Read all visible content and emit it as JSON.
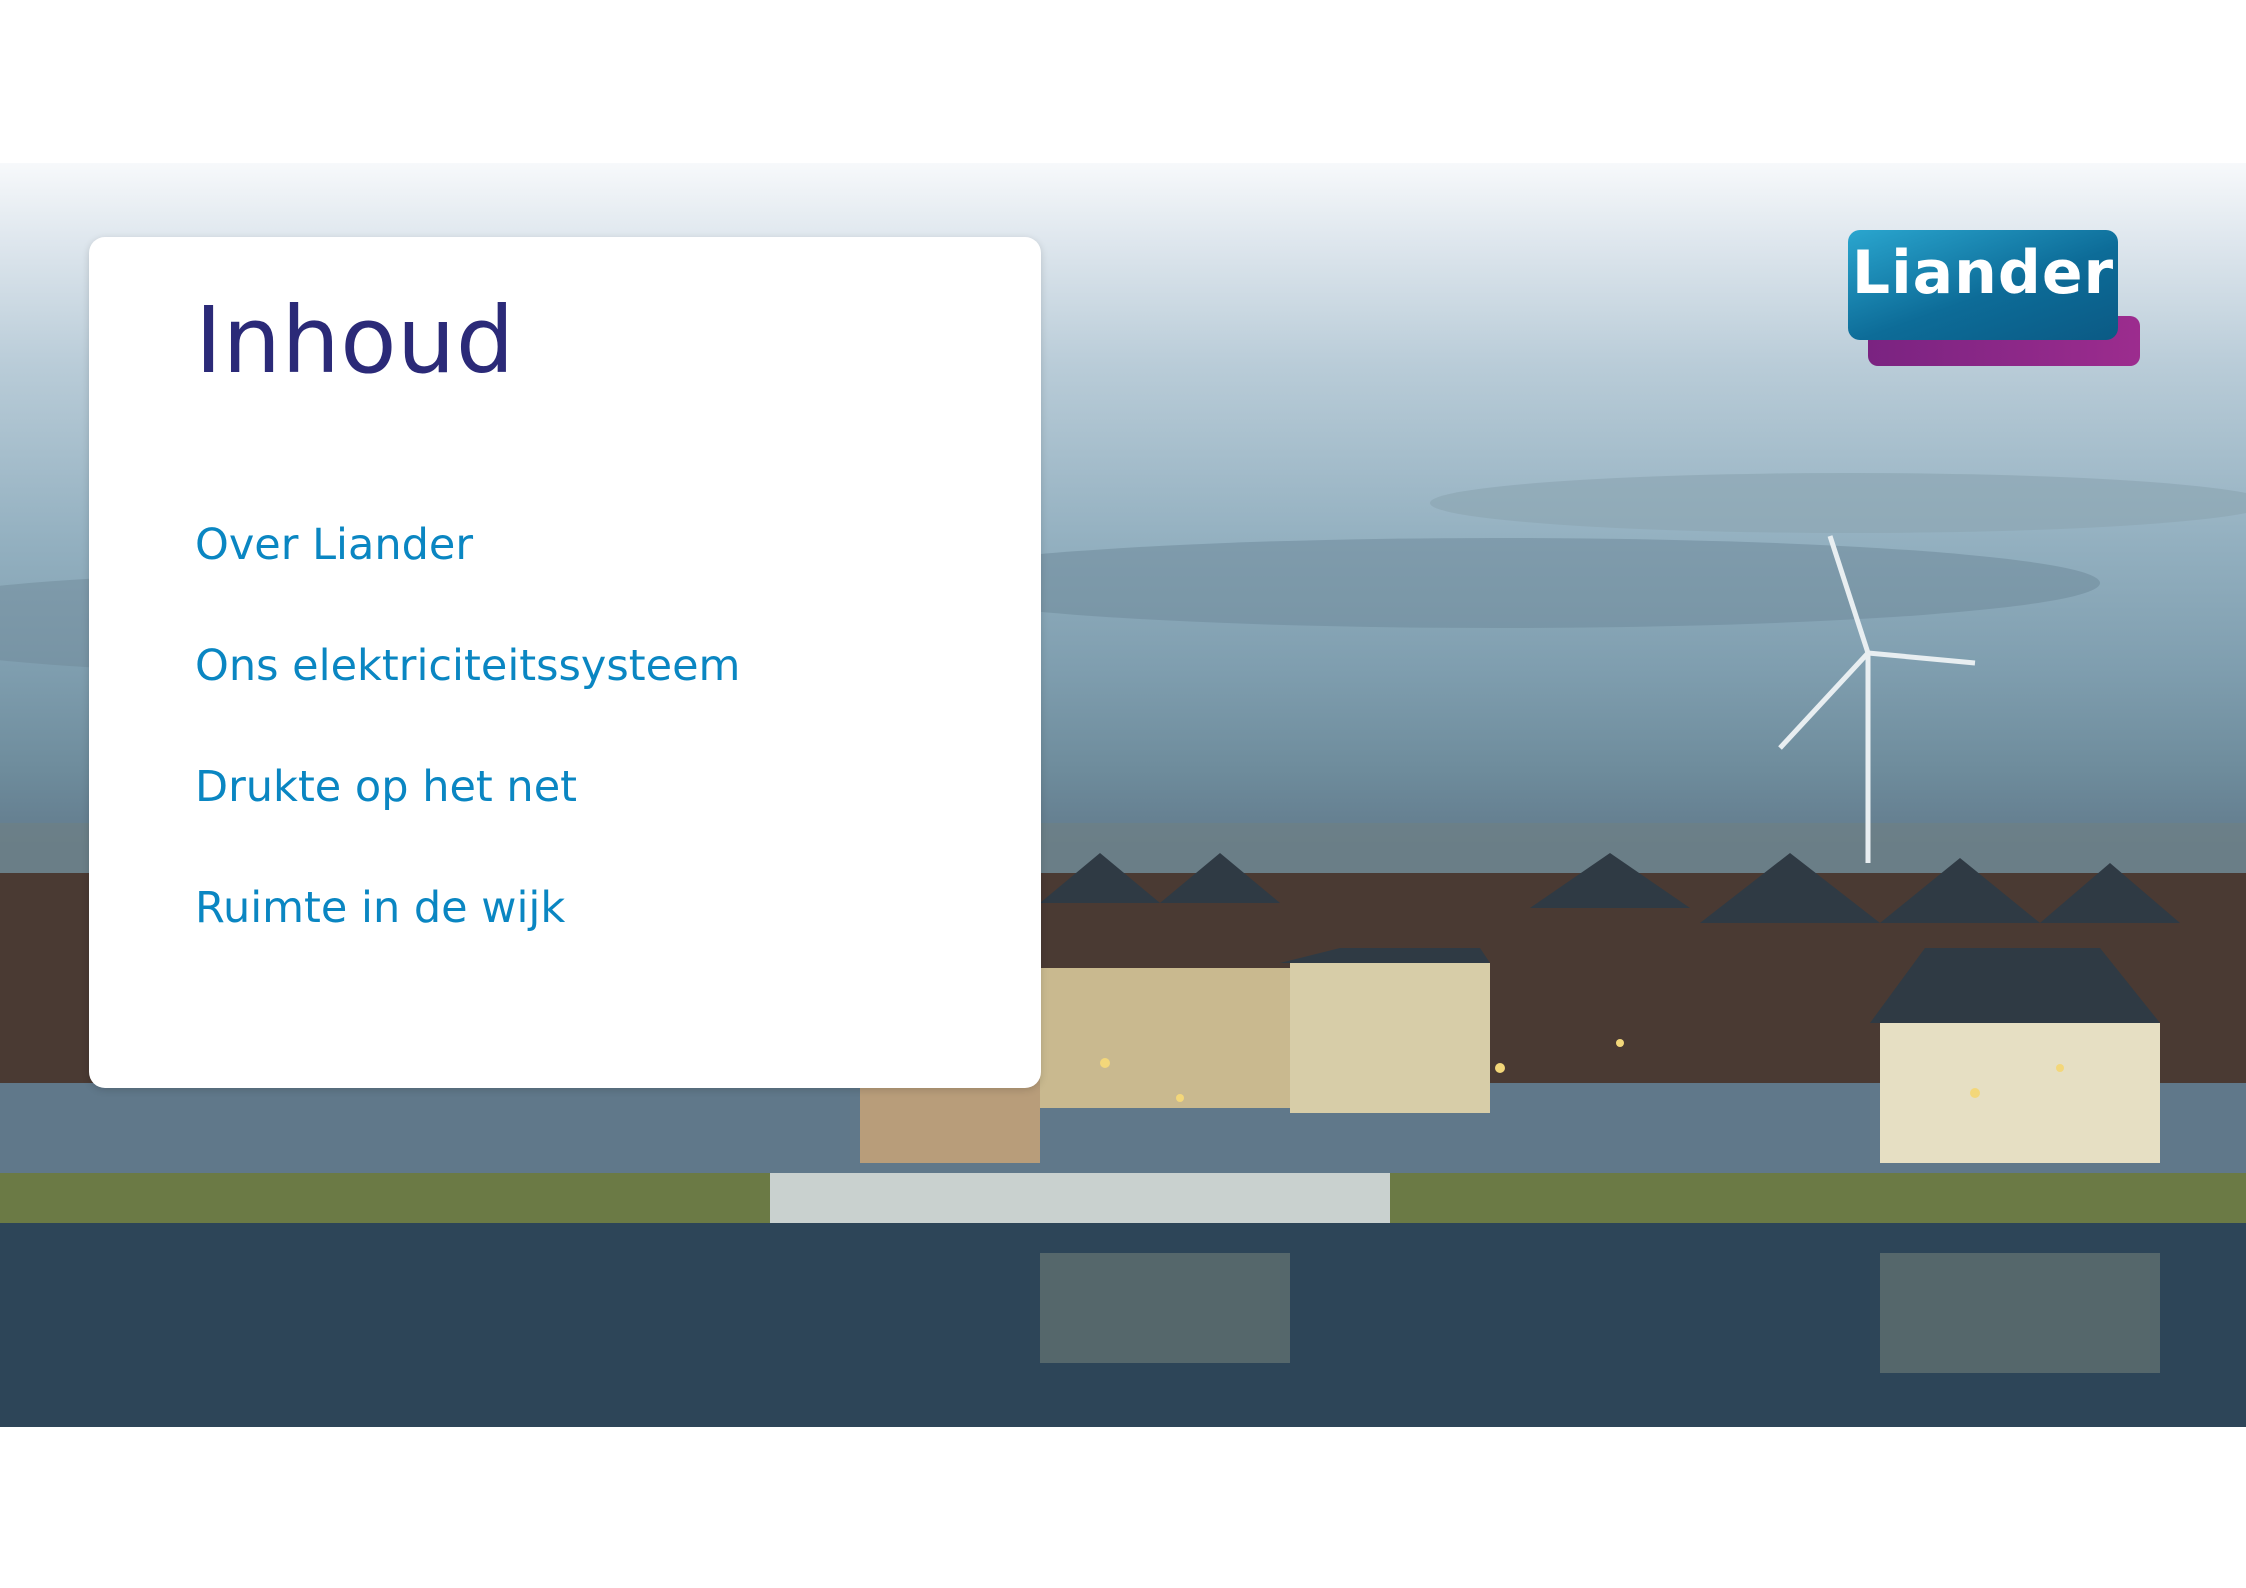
{
  "slide": {
    "title": "Inhoud",
    "items": [
      {
        "label": "Over Liander"
      },
      {
        "label": "Ons elektriciteitssysteem"
      },
      {
        "label": "Drukte op het net"
      },
      {
        "label": "Ruimte in de wijk"
      }
    ]
  },
  "logo": {
    "text": "Liander"
  },
  "colors": {
    "title": "#2b2a78",
    "link": "#0a86c2",
    "logo_blue": "#0d6c98",
    "logo_purple": "#8a2886"
  }
}
